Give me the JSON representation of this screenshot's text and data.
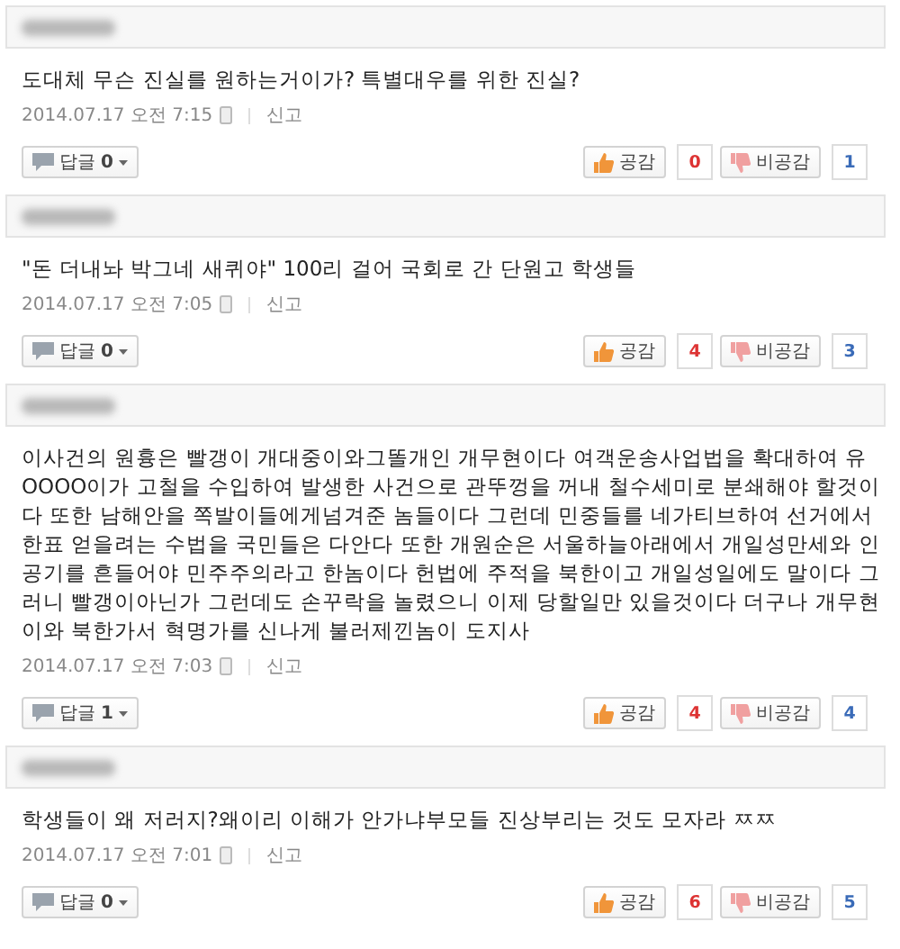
{
  "comments": [
    {
      "text": "도대체 무슨 진실를 원하는거이가? 특별대우를 위한 진실?",
      "date": "2014.07.17 오전 7:15",
      "report": "신고",
      "reply": {
        "label": "답글",
        "count": "0"
      },
      "like": {
        "label": "공감",
        "count": "0"
      },
      "dislike": {
        "label": "비공감",
        "count": "1"
      }
    },
    {
      "text": "\"돈 더내놔 박그네 새퀴야\" 100리 걸어 국회로 간 단원고 학생들",
      "date": "2014.07.17 오전 7:05",
      "report": "신고",
      "reply": {
        "label": "답글",
        "count": "0"
      },
      "like": {
        "label": "공감",
        "count": "4"
      },
      "dislike": {
        "label": "비공감",
        "count": "3"
      }
    },
    {
      "text": "이사건의 원흉은 빨갱이 개대중이와그똘개인 개무현이다 여객운송사업법을 확대하여 유OOOO이가 고철을 수입하여 발생한 사건으로 관뚜껑을 꺼내 철수세미로 분쇄해야 할것이다 또한 남해안을 쪽발이들에게넘겨준 놈들이다 그런데 민중들를 네가티브하여 선거에서 한표 얻을려는 수법을 국민들은 다안다 또한 개원순은 서울하늘아래에서 개일성만세와 인공기를 흔들어야 민주주의라고 한놈이다 헌법에 주적을 북한이고 개일성일에도 말이다 그러니 빨갱이아닌가 그런데도 손꾸락을 놀렸으니 이제 당할일만 있을것이다 더구나 개무현이와 북한가서 혁명가를 신나게 불러제낀놈이 도지사",
      "date": "2014.07.17 오전 7:03",
      "report": "신고",
      "reply": {
        "label": "답글",
        "count": "1"
      },
      "like": {
        "label": "공감",
        "count": "4"
      },
      "dislike": {
        "label": "비공감",
        "count": "4"
      }
    },
    {
      "text": "학생들이 왜 저러지?왜이리 이해가 안가냐부모들 진상부리는 것도 모자라 ㅉㅉ",
      "date": "2014.07.17 오전 7:01",
      "report": "신고",
      "reply": {
        "label": "답글",
        "count": "0"
      },
      "like": {
        "label": "공감",
        "count": "6"
      },
      "dislike": {
        "label": "비공감",
        "count": "5"
      }
    }
  ]
}
